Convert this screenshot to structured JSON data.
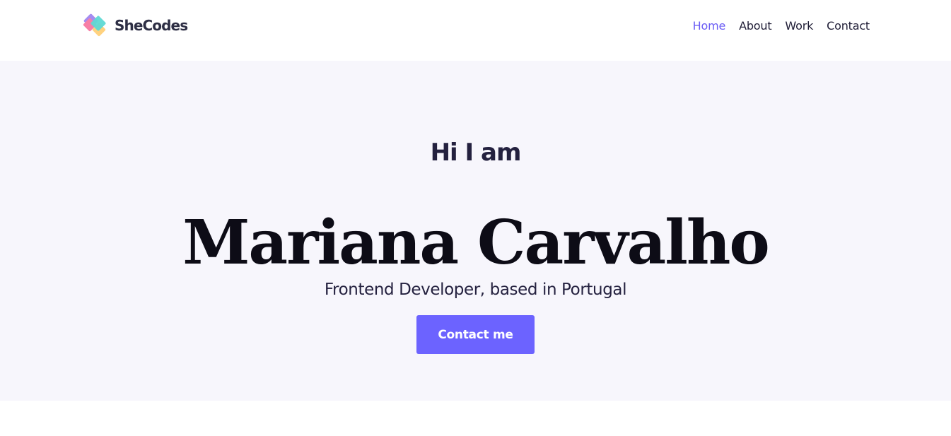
{
  "navbar": {
    "logo_text": "SheCodes",
    "links": [
      {
        "label": "Home",
        "active": true
      },
      {
        "label": "About",
        "active": false
      },
      {
        "label": "Work",
        "active": false
      },
      {
        "label": "Contact",
        "active": false
      }
    ]
  },
  "hero": {
    "greeting": "Hi I am",
    "name": "Mariana Carvalho",
    "subtitle": "Frontend Developer, based in Portugal",
    "cta_label": "Contact me"
  },
  "colors": {
    "accent": "#6c63ff",
    "active_link": "#6a5cf5",
    "hero_background": "#f7f6fc",
    "text_dark": "#1f1d36",
    "logo_pink": "#f77fa6",
    "logo_purple": "#a58cf0",
    "logo_teal": "#5fd9d4",
    "logo_yellow": "#ffd27f"
  },
  "icons": {
    "logo": "shecodes-logo-icon"
  }
}
